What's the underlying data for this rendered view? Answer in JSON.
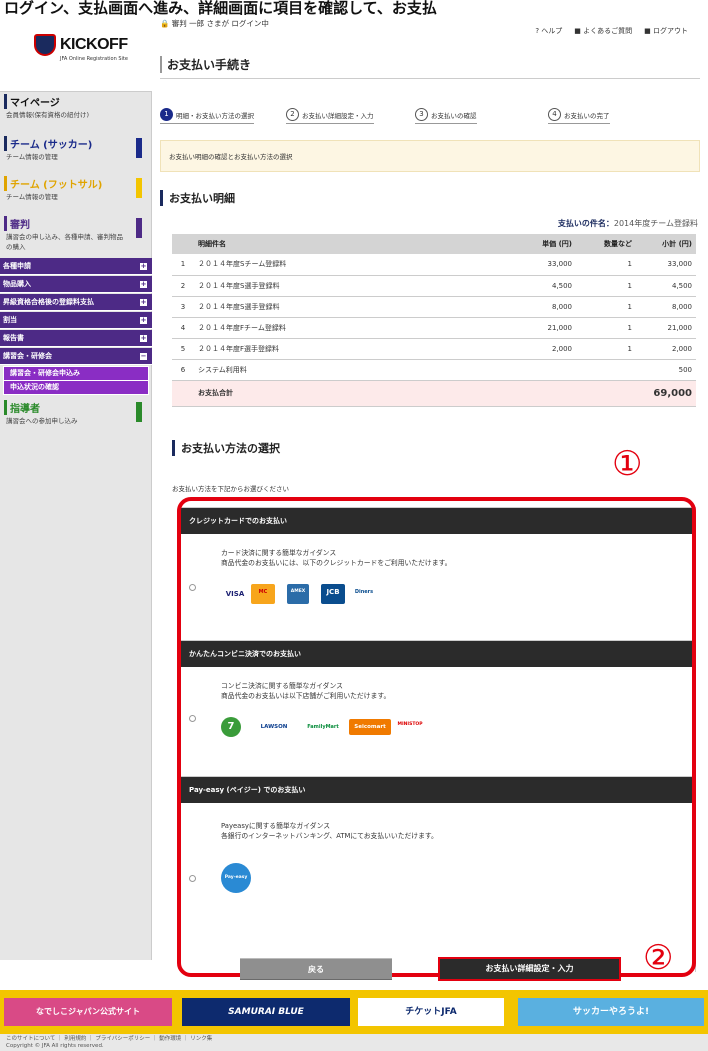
{
  "top_caption": "ログイン、支払画面へ進み、詳細画面に項目を確認して、お支払",
  "login_status": "審判 一郎 さまが ログイン中",
  "header_links": [
    "ヘルプ",
    "よくあるご質問",
    "ログアウト"
  ],
  "logo": {
    "text": "KICKOFF",
    "sub": "JFA Online Registration Site"
  },
  "sidebar": {
    "mypage": {
      "title": "マイページ",
      "desc": "会員情報(保有資格の紐付け)"
    },
    "team_soccer": {
      "title": "チーム (サッカー)",
      "desc": "チーム情報の管理"
    },
    "team_futsal": {
      "title": "チーム (フットサル)",
      "desc": "チーム情報の管理"
    },
    "referee": {
      "title": "審判",
      "desc": "講習会の申し込み、各種申請、審判物品の購入"
    },
    "menu": [
      "各種申請",
      "物品購入",
      "昇級資格合格後の登録料支払",
      "割当",
      "報告書",
      "講習会・研修会"
    ],
    "submenu": [
      "講習会・研修会申込み",
      "申込状況の確認"
    ],
    "coach": {
      "title": "指導者",
      "desc": "講習会への参加申し込み"
    }
  },
  "page_title": "お支払い手続き",
  "steps": [
    {
      "num": "1",
      "label": "明細・お支払い方法の選択"
    },
    {
      "num": "2",
      "label": "お支払い詳細設定・入力"
    },
    {
      "num": "3",
      "label": "お支払いの確認"
    },
    {
      "num": "4",
      "label": "お支払いの完了"
    }
  ],
  "notice": "お支払い明細の確認とお支払い方法の選択",
  "detail": {
    "heading": "お支払い明細",
    "case_label": "支払いの件名：",
    "case_value": "2014年度チーム登録料",
    "columns": [
      "明細件名",
      "単価 (円)",
      "数量など",
      "小計 (円)"
    ],
    "rows": [
      {
        "no": "1",
        "name": "２０１４年度Sチーム登録料",
        "price": "33,000",
        "qty": "1",
        "subtotal": "33,000"
      },
      {
        "no": "2",
        "name": "２０１４年度S選手登録料",
        "price": "4,500",
        "qty": "1",
        "subtotal": "4,500"
      },
      {
        "no": "3",
        "name": "２０１４年度S選手登録料",
        "price": "8,000",
        "qty": "1",
        "subtotal": "8,000"
      },
      {
        "no": "4",
        "name": "２０１４年度Fチーム登録料",
        "price": "21,000",
        "qty": "1",
        "subtotal": "21,000"
      },
      {
        "no": "5",
        "name": "２０１４年度F選手登録料",
        "price": "2,000",
        "qty": "1",
        "subtotal": "2,000"
      },
      {
        "no": "6",
        "name": "システム利用料",
        "price": "",
        "qty": "",
        "subtotal": "500"
      }
    ],
    "total_label": "お支払合計",
    "total_value": "69,000"
  },
  "method": {
    "heading": "お支払い方法の選択",
    "intro": "お支払い方法を下記からお選びください",
    "options": [
      {
        "title": "クレジットカードでのお支払い",
        "line1": "カード決済に関する簡単なガイダンス",
        "line2": "商品代金のお支払いには、以下のクレジットカードをご利用いただけます。",
        "logos": [
          "VISA",
          "MC",
          "AMEX",
          "JCB",
          "Diners"
        ]
      },
      {
        "title": "かんたんコンビニ決済でのお支払い",
        "line1": "コンビニ決済に関する簡単なガイダンス",
        "line2": "商品代金のお支払いは以下店舗がご利用いただけます。",
        "logos": [
          "7",
          "LAWSON",
          "FamilyMart",
          "Seicomart",
          "MINISTOP"
        ]
      },
      {
        "title": "Pay-easy (ペイジー) でのお支払い",
        "line1": "Payeasyに関する簡単なガイダンス",
        "line2": "各銀行のインターネットバンキング、ATMにてお支払いいただけます。",
        "logos": [
          "Pay-easy"
        ]
      }
    ]
  },
  "callouts": [
    "①",
    "②"
  ],
  "buttons": {
    "back": "戻る",
    "next": "お支払い詳細設定・入力"
  },
  "banner": {
    "nadeshiko": "なでしこジャパン公式サイト",
    "samurai": "SAMURAI BLUE",
    "ticket": "チケットJFA",
    "soccer": "サッカーやろうよ!"
  },
  "footer": {
    "links": "このサイトについて ｜ 利用規約 ｜ プライバシーポリシー ｜ 動作環境 ｜ リンク集",
    "copyright": "Copyright © JFA All rights reserved."
  },
  "colors": {
    "navy": "#1a2a5e",
    "purple": "#4d2a86",
    "red": "#e3000f",
    "banner_yellow": "#f3c500"
  }
}
